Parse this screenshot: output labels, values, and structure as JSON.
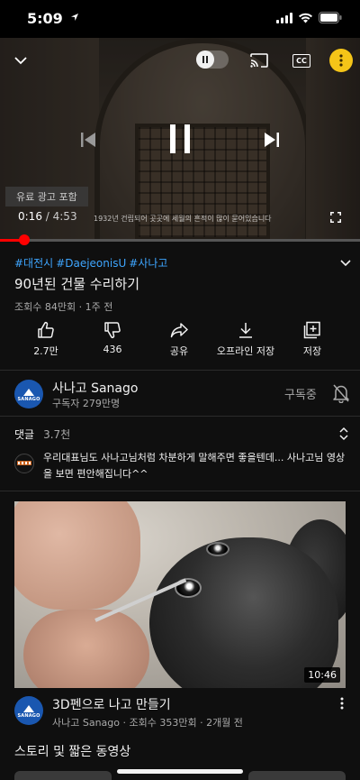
{
  "status_bar": {
    "time": "5:09"
  },
  "player": {
    "caption_overlay": "1932년 건립되어 곳곳에 세월의 흔적이 많이 묻어있습니다",
    "ad_label": "유료 광고 포함",
    "current_time": "0:16",
    "separator": " / ",
    "duration": "4:53",
    "progress_fraction": 0.055,
    "cc_label": "CC",
    "colors": {
      "progress": "#ff0000",
      "accent_more": "#f5c518"
    }
  },
  "video": {
    "hashtags": [
      "#대전시",
      "#DaejeonisU",
      "#사나고"
    ],
    "title": "90년된 건물 수리하기",
    "meta": "조회수 84만회 · 1주 전"
  },
  "actions": [
    {
      "icon": "thumbs-up-icon",
      "label": "2.7만"
    },
    {
      "icon": "thumbs-down-icon",
      "label": "436"
    },
    {
      "icon": "share-icon",
      "label": "공유"
    },
    {
      "icon": "download-icon",
      "label": "오프라인 저장"
    },
    {
      "icon": "save-playlist-icon",
      "label": "저장"
    }
  ],
  "channel": {
    "name": "사나고 Sanago",
    "subscribers": "구독자 279만명",
    "subscribe_state": "구독중",
    "avatar_text": "SANAGO"
  },
  "comments": {
    "label": "댓글",
    "count": "3.7천",
    "top_comment": "우리대표님도 사나고님처럼 차분하게 말해주면 좋을텐데... 사나고님 영상을 보면 편안해집니다^^"
  },
  "recommended": {
    "duration": "10:46",
    "title": "3D펜으로 나고 만들기",
    "meta": "사나고 Sanago · 조회수 353만회 · 2개월 전"
  },
  "shelf": {
    "title": "스토리 및 짧은 동영상"
  }
}
